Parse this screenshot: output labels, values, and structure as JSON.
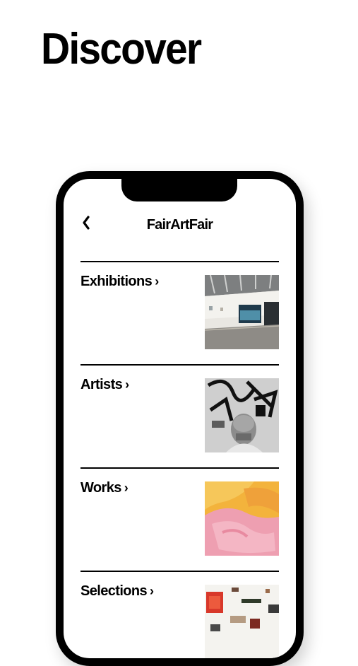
{
  "page": {
    "headline": "Discover"
  },
  "nav": {
    "title": "FairArtFair",
    "back_icon": "chevron-left-icon"
  },
  "sections": [
    {
      "label": "Exhibitions",
      "chevron": "›",
      "thumbnail": "gallery-interior-image"
    },
    {
      "label": "Artists",
      "chevron": "›",
      "thumbnail": "artist-portrait-image"
    },
    {
      "label": "Works",
      "chevron": "›",
      "thumbnail": "abstract-painting-image"
    },
    {
      "label": "Selections",
      "chevron": "›",
      "thumbnail": "gallery-wall-image"
    }
  ]
}
